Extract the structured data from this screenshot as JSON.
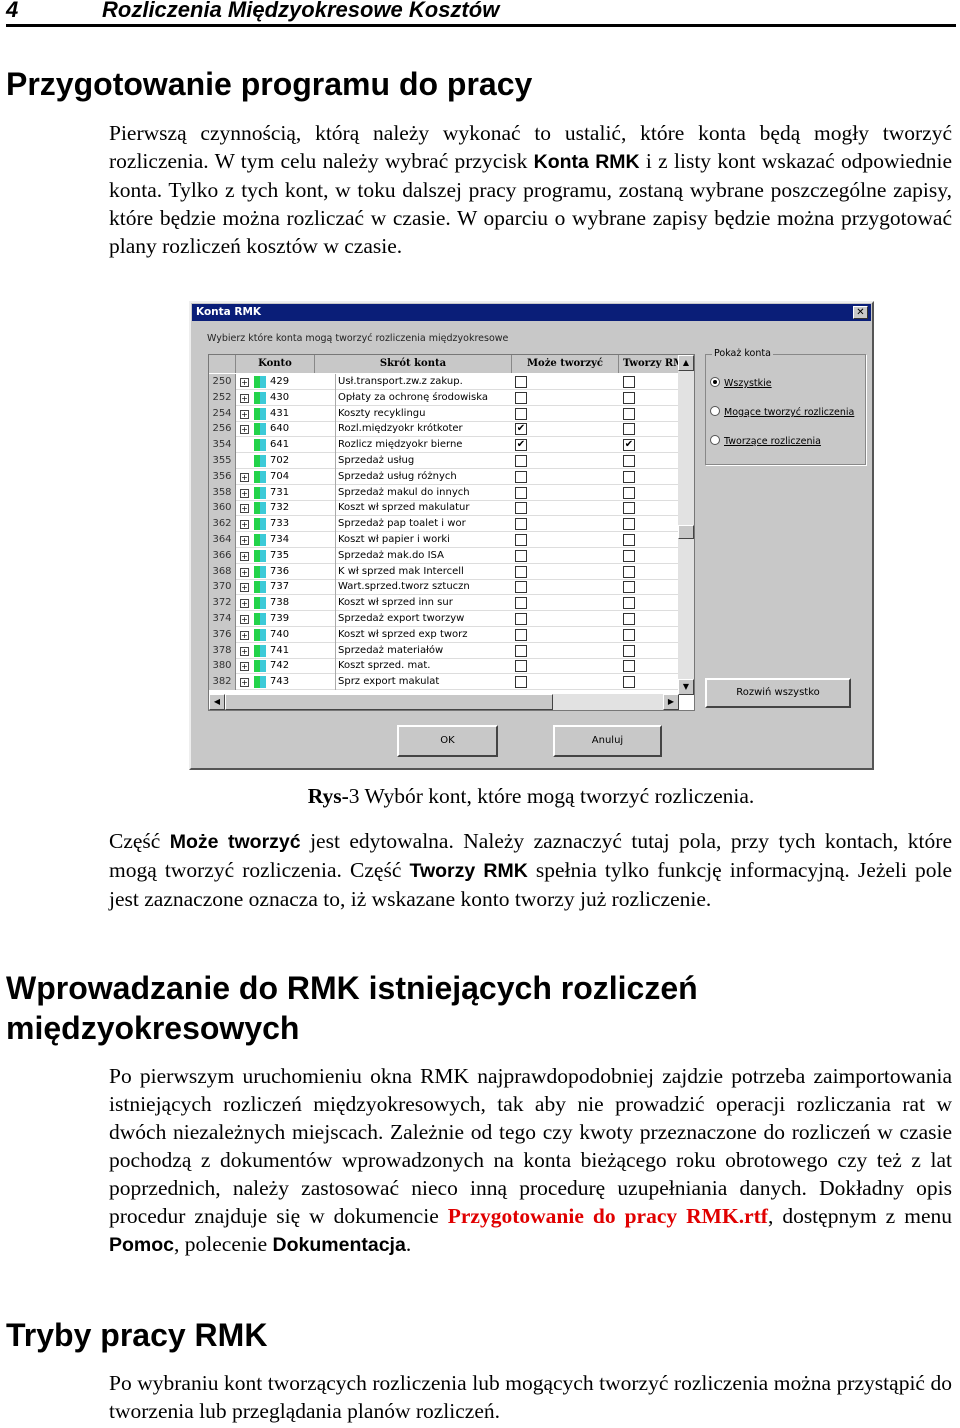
{
  "header": {
    "page_number": "4",
    "title": "Rozliczenia Międzyokresowe Kosztów"
  },
  "section1": {
    "heading": "Przygotowanie programu do pracy",
    "paragraph": [
      {
        "t": "Pierwszą czynnością, którą należy wykonać to ustalić, które konta będą mogły tworzyć rozliczenia. W tym celu należy wybrać przycisk "
      },
      {
        "t": "Konta RMK",
        "s": "b"
      },
      {
        "t": " i z listy kont wskazać odpowiednie konta. Tylko z tych kont, w toku dalszej pracy programu, zostaną wybrane poszczególne zapisy, które będzie można rozliczać w czasie. W oparciu o wybrane zapisy będzie można przygotować plany rozliczeń kosztów w czasie."
      }
    ]
  },
  "dialog": {
    "title": "Konta RMK",
    "close": "✕",
    "instruction": "Wybierz które konta mogą tworzyć rozliczenia międzyokresowe",
    "columns": [
      "Konto",
      "Skrót konta",
      "Może tworzyć",
      "Tworzy RMK"
    ],
    "rows": [
      {
        "n": "250",
        "konto": "429",
        "skrot": "Usł.transport.zw.z zakup.",
        "expand": true,
        "moze": false,
        "tworzy": false
      },
      {
        "n": "252",
        "konto": "430",
        "skrot": "Opłaty za ochronę środowiska",
        "expand": true,
        "moze": false,
        "tworzy": false
      },
      {
        "n": "254",
        "konto": "431",
        "skrot": "Koszty recyklingu",
        "expand": true,
        "moze": false,
        "tworzy": false
      },
      {
        "n": "256",
        "konto": "640",
        "skrot": "Rozl.międzyokr krótkoter",
        "expand": true,
        "moze": true,
        "tworzy": false
      },
      {
        "n": "354",
        "konto": "641",
        "skrot": "Rozlicz międzyokr bierne",
        "expand": false,
        "moze": true,
        "tworzy": true
      },
      {
        "n": "355",
        "konto": "702",
        "skrot": "Sprzedaż usług",
        "expand": false,
        "moze": false,
        "tworzy": false
      },
      {
        "n": "356",
        "konto": "704",
        "skrot": "Sprzedaż usług różnych",
        "expand": true,
        "moze": false,
        "tworzy": false
      },
      {
        "n": "358",
        "konto": "731",
        "skrot": "Sprzedaż makul do innych",
        "expand": true,
        "moze": false,
        "tworzy": false
      },
      {
        "n": "360",
        "konto": "732",
        "skrot": "Koszt wł sprzed makulatur",
        "expand": true,
        "moze": false,
        "tworzy": false
      },
      {
        "n": "362",
        "konto": "733",
        "skrot": "Sprzedaż pap toalet i wor",
        "expand": true,
        "moze": false,
        "tworzy": false
      },
      {
        "n": "364",
        "konto": "734",
        "skrot": "Koszt wł papier i worki",
        "expand": true,
        "moze": false,
        "tworzy": false
      },
      {
        "n": "366",
        "konto": "735",
        "skrot": "Sprzedaż mak.do ISA",
        "expand": true,
        "moze": false,
        "tworzy": false
      },
      {
        "n": "368",
        "konto": "736",
        "skrot": "K wł sprzed mak Intercell",
        "expand": true,
        "moze": false,
        "tworzy": false
      },
      {
        "n": "370",
        "konto": "737",
        "skrot": "Wart.sprzed.tworz sztuczn",
        "expand": true,
        "moze": false,
        "tworzy": false
      },
      {
        "n": "372",
        "konto": "738",
        "skrot": "Koszt wł sprzed inn sur",
        "expand": true,
        "moze": false,
        "tworzy": false
      },
      {
        "n": "374",
        "konto": "739",
        "skrot": "Sprzedaż export tworzyw",
        "expand": true,
        "moze": false,
        "tworzy": false
      },
      {
        "n": "376",
        "konto": "740",
        "skrot": "Koszt wł sprzed exp tworz",
        "expand": true,
        "moze": false,
        "tworzy": false
      },
      {
        "n": "378",
        "konto": "741",
        "skrot": "Sprzedaż materiałów",
        "expand": true,
        "moze": false,
        "tworzy": false
      },
      {
        "n": "380",
        "konto": "742",
        "skrot": "Koszt sprzed. mat.",
        "expand": true,
        "moze": false,
        "tworzy": false
      },
      {
        "n": "382",
        "konto": "743",
        "skrot": "Sprz export makulat",
        "expand": true,
        "moze": false,
        "tworzy": false
      }
    ],
    "group_label": "Pokaż konta",
    "radios": [
      {
        "label": "Wszystkie",
        "selected": true
      },
      {
        "label": "Mogące tworzyć rozliczenia",
        "selected": false
      },
      {
        "label": "Tworzące rozliczenia",
        "selected": false
      }
    ],
    "expand_all": "Rozwiń wszystko",
    "ok": "OK",
    "cancel": "Anuluj"
  },
  "caption": {
    "label": "Rys-",
    "rest": "3 Wybór kont, które mogą tworzyć rozliczenia."
  },
  "para2": [
    {
      "t": "Część "
    },
    {
      "t": "Może tworzyć",
      "s": "b"
    },
    {
      "t": " jest edytowalna. Należy zaznaczyć tutaj pola, przy tych kontach, które mogą tworzyć rozliczenia. Część "
    },
    {
      "t": "Tworzy RMK",
      "s": "b"
    },
    {
      "t": " spełnia tylko funkcję informacyjną. Jeżeli pole jest zaznaczone oznacza to, iż wskazane konto tworzy już rozliczenie."
    }
  ],
  "section2": {
    "heading": "Wprowadzanie do RMK istniejących rozliczeń międzyokresowych",
    "paragraph": [
      {
        "t": "Po pierwszym uruchomieniu okna RMK najprawdopodobniej zajdzie potrzeba zaimportowania istniejących rozliczeń międzyokresowych, tak aby nie prowadzić operacji rozliczania rat w dwóch niezależnych miejscach. Zależnie od tego czy kwoty przeznaczone do rozliczeń w czasie pochodzą z dokumentów wprowadzonych na konta bieżącego roku obrotowego czy też z lat poprzednich, należy zastosować nieco inną procedurę uzupełniania danych. Dokładny opis procedur znajduje się w dokumencie "
      },
      {
        "t": "Przygotowanie do pracy RMK.rtf",
        "s": "red"
      },
      {
        "t": ", dostępnym z menu "
      },
      {
        "t": "Pomoc",
        "s": "b"
      },
      {
        "t": ", polecenie "
      },
      {
        "t": "Dokumentacja",
        "s": "b"
      },
      {
        "t": "."
      }
    ]
  },
  "section3": {
    "heading": "Tryby pracy RMK",
    "paragraph": [
      {
        "t": "Po wybraniu kont tworzących rozliczenia lub mogących tworzyć rozliczenia można przystąpić do tworzenia lub przeglądania planów rozliczeń."
      }
    ]
  },
  "colors": {
    "titlebar": "#0a1e78",
    "dialog_bg": "#c8c8c8",
    "link": "#e00000",
    "konto_icon": "#22d34a"
  }
}
